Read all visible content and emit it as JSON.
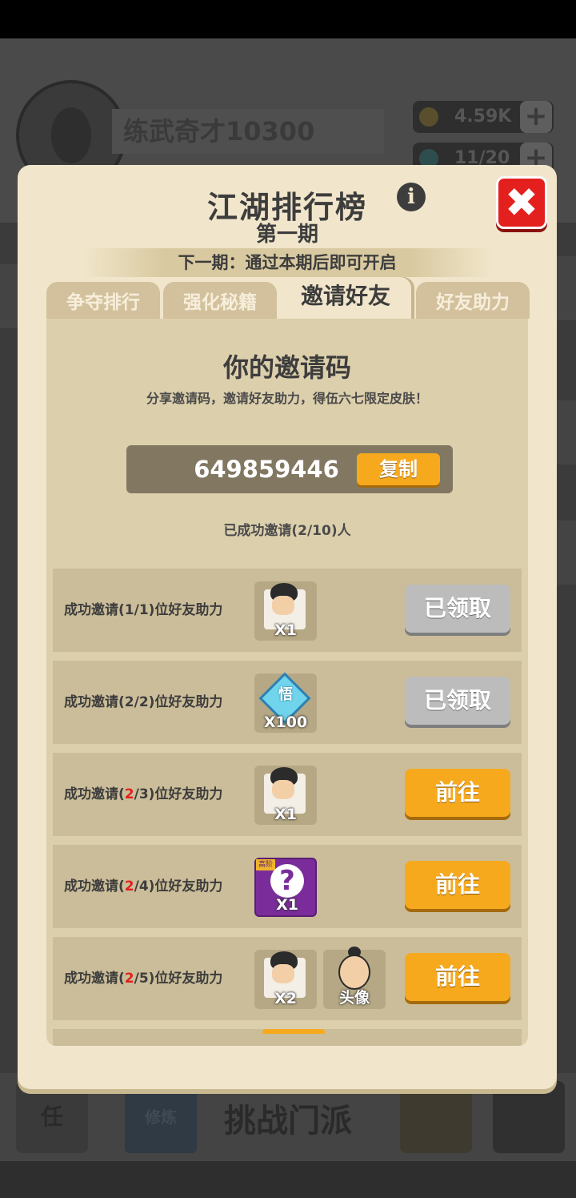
{
  "background": {
    "player_name": "练武奇才10300",
    "coins": "4.59K",
    "gems": "11/20",
    "bottom_center_label": "挑战门派",
    "bottom_left_label": "任",
    "bottom_second_label": "修炼"
  },
  "modal": {
    "title": "江湖排行榜",
    "subtitle": "第一期",
    "next_period": "下一期：通过本期后即可开启",
    "tabs": [
      "争夺排行",
      "强化秘籍",
      "邀请好友",
      "好友助力"
    ],
    "active_tab": "邀请好友"
  },
  "invite": {
    "title": "你的邀请码",
    "description": "分享邀请码，邀请好友助力，得伍六七限定皮肤！",
    "code": "649859446",
    "copy_label": "复制",
    "success_count": "已成功邀请(2/10)人"
  },
  "tasks": [
    {
      "prefix": "成功邀请(",
      "current": "1",
      "current_red": false,
      "suffix": "/1)位好友助力",
      "rewards": [
        {
          "type": "hero-fragment",
          "qty": "X1"
        }
      ],
      "button": "已领取",
      "state": "claimed"
    },
    {
      "prefix": "成功邀请(",
      "current": "2",
      "current_red": false,
      "suffix": "/2)位好友助力",
      "rewards": [
        {
          "type": "diamond",
          "glyph": "悟",
          "qty": "X100"
        }
      ],
      "button": "已领取",
      "state": "claimed"
    },
    {
      "prefix": "成功邀请(",
      "current": "2",
      "current_red": true,
      "suffix": "/3)位好友助力",
      "rewards": [
        {
          "type": "hero-fragment",
          "qty": "X1"
        }
      ],
      "button": "前往",
      "state": "go"
    },
    {
      "prefix": "成功邀请(",
      "current": "2",
      "current_red": true,
      "suffix": "/4)位好友助力",
      "rewards": [
        {
          "type": "mystery",
          "tag": "高阶",
          "qty": "X1"
        }
      ],
      "button": "前往",
      "state": "go"
    },
    {
      "prefix": "成功邀请(",
      "current": "2",
      "current_red": true,
      "suffix": "/5)位好友助力",
      "rewards": [
        {
          "type": "hero-fragment",
          "qty": "X2"
        },
        {
          "type": "avatar",
          "qty": "头像"
        }
      ],
      "button": "前往",
      "state": "go"
    }
  ],
  "colors": {
    "modal_bg": "#f1e6cb",
    "panel_bg": "#dccfac",
    "row_bg": "#cbbd99",
    "go_button": "#f7a91e",
    "claimed_button": "#bcbcbc",
    "close_button": "#e3201e",
    "highlight_red": "#e0201c"
  }
}
